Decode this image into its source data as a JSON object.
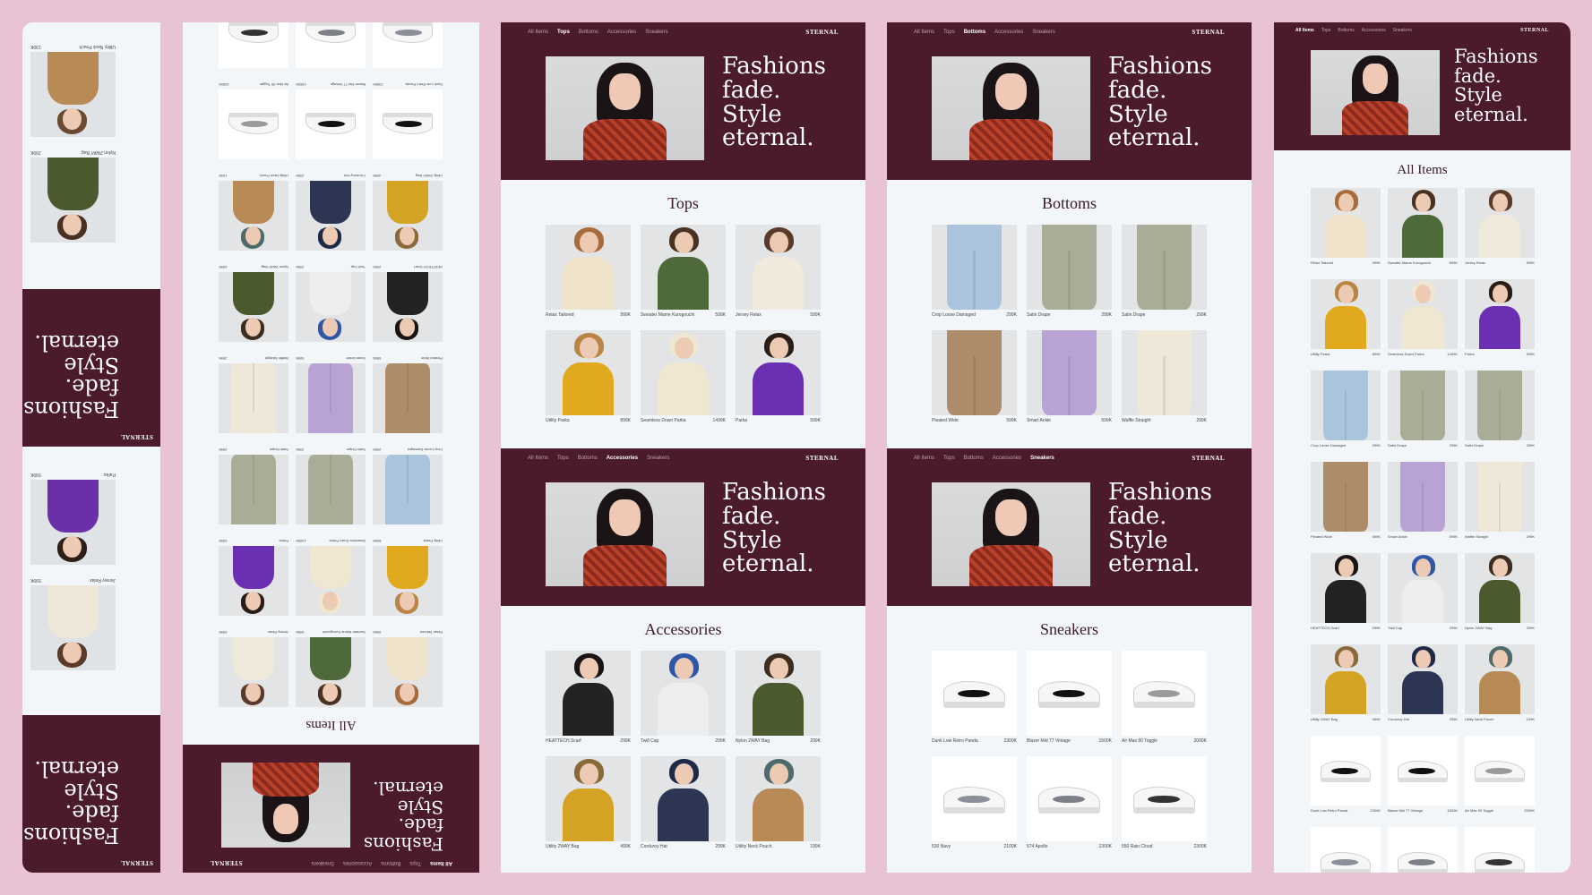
{
  "brand": "STERNAL",
  "hero_lines": [
    "Fashions",
    "fade.",
    "Style",
    "eternal."
  ],
  "nav_links": [
    "All Items",
    "Tops",
    "Bottoms",
    "Accessories",
    "Sneakers"
  ],
  "sections": {
    "tops": {
      "title": "Tops",
      "items": [
        {
          "name": "Relax Tailored",
          "price": "999K"
        },
        {
          "name": "Sweater Mame Kurogouchi",
          "price": "599K"
        },
        {
          "name": "Jersey Relax",
          "price": "599K"
        },
        {
          "name": "Utility Parka",
          "price": "899K"
        },
        {
          "name": "Seamless Down Parka",
          "price": "1499K"
        },
        {
          "name": "Parka",
          "price": "599K"
        }
      ]
    },
    "bottoms": {
      "title": "Bottoms",
      "items": [
        {
          "name": "Crop Loose Damaged",
          "price": "299K"
        },
        {
          "name": "Satin Drape",
          "price": "299K"
        },
        {
          "name": "Satin Drape",
          "price": "299K"
        },
        {
          "name": "Pleated Wide",
          "price": "599K"
        },
        {
          "name": "Smart Ankle",
          "price": "599K"
        },
        {
          "name": "Waffle Straight",
          "price": "299K"
        }
      ]
    },
    "accessories": {
      "title": "Accessories",
      "items": [
        {
          "name": "HEATTECH Scarf",
          "price": "299K"
        },
        {
          "name": "Twill Cap",
          "price": "299K"
        },
        {
          "name": "Nylon 2WAY Bag",
          "price": "299K"
        },
        {
          "name": "Utility 2WAY Bag",
          "price": "499K"
        },
        {
          "name": "Corduroy Hat",
          "price": "299K"
        },
        {
          "name": "Utility Neck Pouch",
          "price": "199K"
        }
      ]
    },
    "sneakers": {
      "title": "Sneakers",
      "items": [
        {
          "name": "Dunk Low Retro Panda",
          "price": "2300K"
        },
        {
          "name": "Blazer Mid 77 Vintage",
          "price": "1500K"
        },
        {
          "name": "Air Max 90 Toggle",
          "price": "2000K"
        },
        {
          "name": "530 Navy",
          "price": "2100K"
        },
        {
          "name": "574 Apollo",
          "price": "1300K"
        },
        {
          "name": "550 Rain Cloud",
          "price": "2300K"
        }
      ]
    }
  },
  "all_items": {
    "title": "All Items",
    "items": [
      {
        "name": "Relax Tailored",
        "price": "999K"
      },
      {
        "name": "Sweater Mame Kurogouchi",
        "price": "599K"
      },
      {
        "name": "Jersey Relax",
        "price": "599K"
      },
      {
        "name": "Utility Parka",
        "price": "899K"
      },
      {
        "name": "Seamless Down Parka",
        "price": "1499K"
      },
      {
        "name": "Parka",
        "price": "599K"
      },
      {
        "name": "Crop Loose Damaged",
        "price": "299K"
      },
      {
        "name": "Satin Drape",
        "price": "299K"
      },
      {
        "name": "Satin Drape",
        "price": "299K"
      },
      {
        "name": "Pleated Wide",
        "price": "599K"
      },
      {
        "name": "Smart Ankle",
        "price": "599K"
      },
      {
        "name": "Waffle Straight",
        "price": "299K"
      },
      {
        "name": "HEATTECH Scarf",
        "price": "299K"
      },
      {
        "name": "Twill Cap",
        "price": "299K"
      },
      {
        "name": "Nylon 2WAY Bag",
        "price": "299K"
      },
      {
        "name": "Utility 2WAY Bag",
        "price": "499K"
      },
      {
        "name": "Corduroy Hat",
        "price": "299K"
      },
      {
        "name": "Utility Neck Pouch",
        "price": "199K"
      },
      {
        "name": "Dunk Low Retro Panda",
        "price": "2300K"
      },
      {
        "name": "Blazer Mid 77 Vintage",
        "price": "1500K"
      },
      {
        "name": "Air Max 90 Toggle",
        "price": "2000K"
      },
      {
        "name": "530 Navy",
        "price": "2100K"
      },
      {
        "name": "574 Apollo",
        "price": "1300K"
      },
      {
        "name": "550 Rain Cloud",
        "price": "2300K"
      }
    ]
  },
  "colors": {
    "background": "#e9c3d3",
    "hero": "#4b1a2b",
    "panel": "#f2f6f8"
  }
}
